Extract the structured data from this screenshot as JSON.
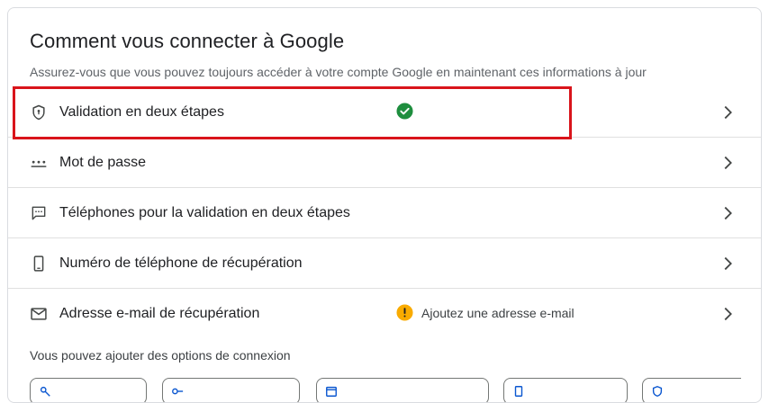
{
  "section": {
    "title": "Comment vous connecter à Google",
    "subtitle": "Assurez-vous que vous pouvez toujours accéder à votre compte Google en maintenant ces informations à jour"
  },
  "rows": [
    {
      "label": "Validation en deux étapes",
      "status": "",
      "status_icon": "check-circle-icon",
      "icon": "shield-icon"
    },
    {
      "label": "Mot de passe",
      "status": "",
      "status_icon": "",
      "icon": "password-dots-icon"
    },
    {
      "label": "Téléphones pour la validation en deux étapes",
      "status": "",
      "status_icon": "",
      "icon": "message-icon"
    },
    {
      "label": "Numéro de téléphone de récupération",
      "status": "",
      "status_icon": "",
      "icon": "phone-icon"
    },
    {
      "label": "Adresse e-mail de récupération",
      "status": "Ajoutez une adresse e-mail",
      "status_icon": "warning-circle-icon",
      "icon": "mail-icon"
    }
  ],
  "add_options": {
    "text": "Vous pouvez ajouter des options de connexion"
  },
  "colors": {
    "highlight": "#d9141b",
    "success": "#1e8e3e",
    "warning": "#f9ab00",
    "text": "#202124",
    "secondary_text": "#5f6368"
  }
}
